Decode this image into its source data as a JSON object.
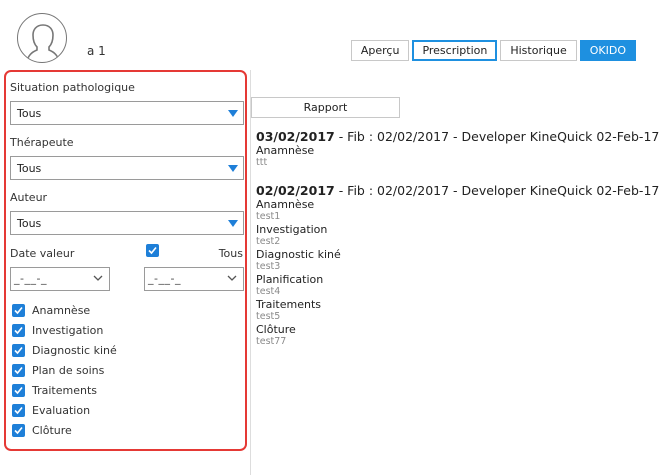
{
  "patient": {
    "name": "a 1"
  },
  "tabs": [
    {
      "label": "Aperçu"
    },
    {
      "label": "Prescription"
    },
    {
      "label": "Historique"
    },
    {
      "label": "OKIDO"
    }
  ],
  "filters": {
    "situation": {
      "label": "Situation pathologique",
      "value": "Tous"
    },
    "therapeute": {
      "label": "Thérapeute",
      "value": "Tous"
    },
    "auteur": {
      "label": "Auteur",
      "value": "Tous"
    },
    "date_valeur": {
      "label": "Date valeur",
      "all_label": "Tous",
      "all_checked": true,
      "from": "_-__-_",
      "to": "_-__-_"
    },
    "sections": [
      {
        "label": "Anamnèse",
        "checked": true
      },
      {
        "label": "Investigation",
        "checked": true
      },
      {
        "label": "Diagnostic kiné",
        "checked": true
      },
      {
        "label": "Plan de soins",
        "checked": true
      },
      {
        "label": "Traitements",
        "checked": true
      },
      {
        "label": "Evaluation",
        "checked": true
      },
      {
        "label": "Clôture",
        "checked": true
      }
    ]
  },
  "report_button": "Rapport",
  "entries": [
    {
      "date": "03/02/2017",
      "info": " - Fib : 02/02/2017 - Developer KineQuick 02-Feb-17",
      "sections": [
        {
          "title": "Anamnèse",
          "value": "ttt"
        }
      ]
    },
    {
      "date": "02/02/2017",
      "info": " - Fib : 02/02/2017 - Developer KineQuick 02-Feb-17",
      "sections": [
        {
          "title": "Anamnèse",
          "value": "test1"
        },
        {
          "title": "Investigation",
          "value": "test2"
        },
        {
          "title": "Diagnostic kiné",
          "value": "test3"
        },
        {
          "title": "Planification",
          "value": "test4"
        },
        {
          "title": "Traitements",
          "value": "test5"
        },
        {
          "title": "Clôture",
          "value": "test77"
        }
      ]
    }
  ],
  "colors": {
    "accent": "#1e90e0",
    "filter_border": "#e53935"
  }
}
